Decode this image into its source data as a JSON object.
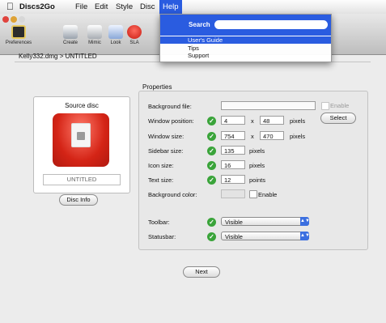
{
  "menubar": {
    "app_name": "Discs2Go",
    "items": [
      "File",
      "Edit",
      "Style",
      "Disc",
      "Help"
    ]
  },
  "toolbar": {
    "items": [
      {
        "label": "Preferences",
        "icon": "preferences-icon"
      },
      {
        "label": "Create",
        "icon": "create-icon"
      },
      {
        "label": "Mimic",
        "icon": "mimic-icon"
      },
      {
        "label": "Look",
        "icon": "look-icon"
      },
      {
        "label": "SLA",
        "icon": "sla-icon"
      }
    ]
  },
  "breadcrumb": "Kelly332.dmg > UNTITLED",
  "source": {
    "title": "Source disc",
    "name": "UNTITLED",
    "info_button": "Disc Info"
  },
  "properties": {
    "title": "Properties",
    "background_file": {
      "label": "Background file:",
      "value": "",
      "enable_label": "Enable",
      "select_button": "Select"
    },
    "window_position": {
      "label": "Window position:",
      "x": "4",
      "sep": "x",
      "y": "48",
      "unit": "pixels"
    },
    "window_size": {
      "label": "Window size:",
      "w": "754",
      "sep": "x",
      "h": "470",
      "unit": "pixels"
    },
    "sidebar_size": {
      "label": "Sidebar size:",
      "value": "135",
      "unit": "pixels"
    },
    "icon_size": {
      "label": "Icon size:",
      "value": "16",
      "unit": "pixels"
    },
    "text_size": {
      "label": "Text size:",
      "value": "12",
      "unit": "points"
    },
    "background_color": {
      "label": "Background color:",
      "enable_label": "Enable"
    },
    "toolbar": {
      "label": "Toolbar:",
      "value": "Visible"
    },
    "statusbar": {
      "label": "Statusbar:",
      "value": "Visible"
    }
  },
  "next_button": "Next",
  "help_menu": {
    "search_label": "Search",
    "search_value": "",
    "items": [
      "User's Guide",
      "Tips",
      "Support"
    ]
  },
  "colors": {
    "accent": "#2a5ce0",
    "check_green": "#3aa43a",
    "disc_red": "#d42416"
  }
}
